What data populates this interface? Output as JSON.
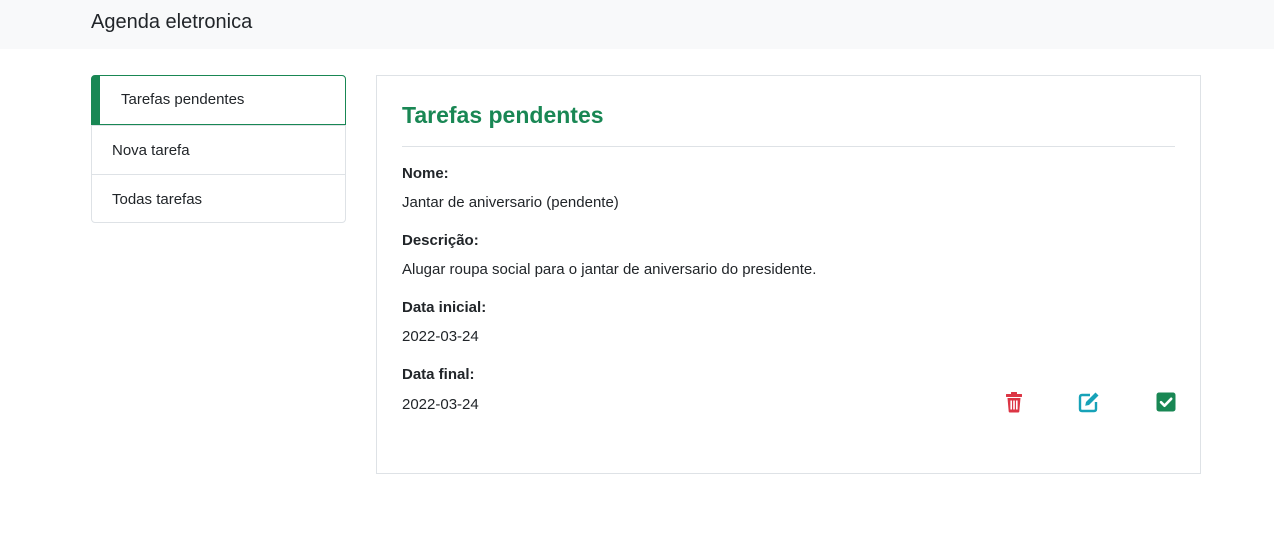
{
  "navbar": {
    "brand": "Agenda eletronica"
  },
  "sidebar": {
    "items": [
      {
        "label": "Tarefas pendentes"
      },
      {
        "label": "Nova tarefa"
      },
      {
        "label": "Todas tarefas"
      }
    ]
  },
  "task": {
    "title": "Tarefas pendentes",
    "name_label": "Nome:",
    "name_value": "Jantar de aniversario (pendente)",
    "description_label": "Descrição:",
    "description_value": "Alugar roupa social para o jantar de aniversario do presidente.",
    "start_label": "Data inicial:",
    "start_value": "2022-03-24",
    "end_label": "Data final:",
    "end_value": "2022-03-24"
  },
  "actions": {
    "delete_icon": "trash-icon",
    "edit_icon": "edit-icon",
    "complete_icon": "check-square-icon"
  },
  "colors": {
    "accent": "#198754",
    "danger": "#dc3545",
    "info": "#17a2b8",
    "navbar_bg": "#f8f9fa"
  }
}
